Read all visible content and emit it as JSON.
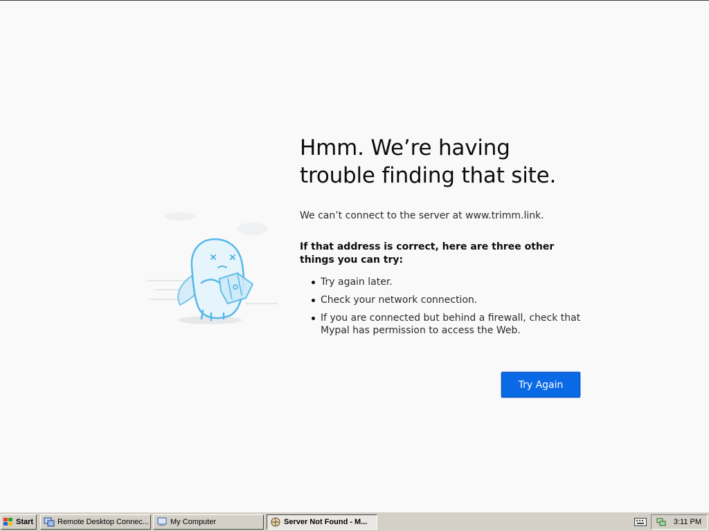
{
  "error_page": {
    "title": "Hmm. We’re having trouble finding that site.",
    "description": "We can’t connect to the server at www.trimm.link.",
    "tips_heading": "If that address is correct, here are three other things you can try:",
    "tips": [
      "Try again later.",
      "Check your network connection.",
      "If you are connected but behind a firewall, check that Mypal has permission to access the Web."
    ],
    "try_again_label": "Try Again",
    "accent_color": "#0a6ae6"
  },
  "taskbar": {
    "start_label": "Start",
    "tasks": [
      {
        "label": "Remote Desktop Connec...",
        "icon": "remote-desktop-icon",
        "active": false
      },
      {
        "label": "My Computer",
        "icon": "my-computer-icon",
        "active": false
      },
      {
        "label": "Server Not Found - M...",
        "icon": "mypal-browser-icon",
        "active": true
      }
    ],
    "clock": "3:11 PM"
  }
}
